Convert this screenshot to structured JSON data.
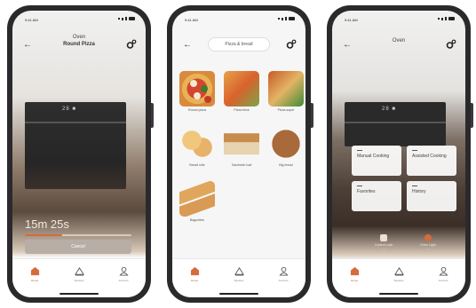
{
  "status": {
    "time": "9:41 AM"
  },
  "tabs": [
    {
      "label": "Home",
      "icon": "home-icon"
    },
    {
      "label": "Recipes",
      "icon": "recipes-icon"
    },
    {
      "label": "Account",
      "icon": "account-icon"
    }
  ],
  "screen1": {
    "title": "Oven",
    "subtitle": "Round Pizza",
    "display": "28 ■",
    "timer": "15m 25s",
    "progress_fraction": 0.35,
    "cancel_label": "Cancel"
  },
  "screen2": {
    "title": "Pizza & bread",
    "items": [
      {
        "label": "Round pizza",
        "kind": "pizza"
      },
      {
        "label": "Pizza thick",
        "kind": "pizza-sl"
      },
      {
        "label": "Pizza super",
        "kind": "pizza-sl2"
      },
      {
        "label": "Bread rolls",
        "kind": "bread-rolls"
      },
      {
        "label": "Sandwich loaf",
        "kind": "bread-loaf"
      },
      {
        "label": "Big bread",
        "kind": "bread-big"
      },
      {
        "label": "Baguettes",
        "kind": "baguette"
      }
    ]
  },
  "screen3": {
    "title": "Oven",
    "display": "28 ■",
    "tiles": [
      {
        "label": "Manual Cooking"
      },
      {
        "label": "Assisted Cooking"
      },
      {
        "label": "Favorites"
      },
      {
        "label": "History"
      }
    ],
    "controls": [
      {
        "label": "Control Lock",
        "state": "Off"
      },
      {
        "label": "Oven Light",
        "state": "On"
      }
    ]
  },
  "colors": {
    "accent": "#d56b3d",
    "dark": "#2a2a2c"
  }
}
